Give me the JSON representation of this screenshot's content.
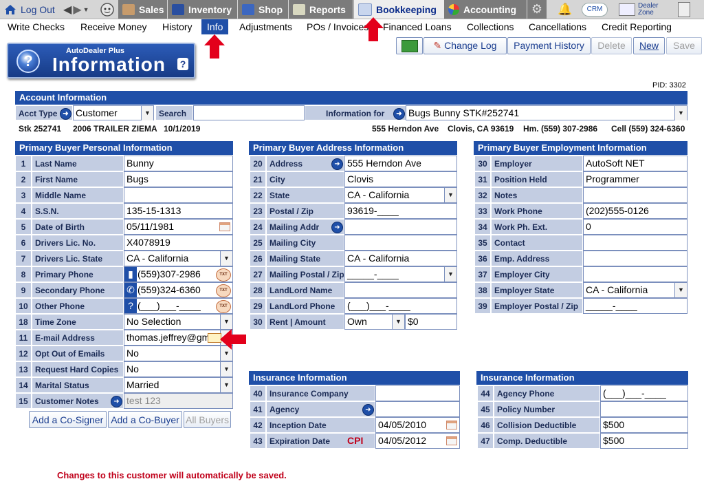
{
  "topnav": {
    "logout": "Log Out",
    "tabs": [
      {
        "label": "Sales",
        "icon": "sales-icon"
      },
      {
        "label": "Inventory",
        "icon": "car-icon"
      },
      {
        "label": "Shop",
        "icon": "wrench-icon"
      },
      {
        "label": "Reports",
        "icon": "report-icon"
      },
      {
        "label": "Bookkeeping",
        "icon": "book-icon"
      },
      {
        "label": "Accounting",
        "icon": "pie-icon"
      }
    ],
    "crm": "CRM",
    "dealer_zone": [
      "Dealer",
      "Zone"
    ]
  },
  "subnav": [
    "Write Checks",
    "Receive Money",
    "History",
    "Info",
    "Adjustments",
    "POs / Invoices",
    "Financed Loans",
    "Collections",
    "Cancellations",
    "Credit Reporting"
  ],
  "logo": {
    "sub": "AutoDealer Plus",
    "main": "Information",
    "q": "?",
    "help": "?"
  },
  "toolbar": {
    "change_log": "Change Log",
    "payment_history": "Payment History",
    "delete": "Delete",
    "new": "New",
    "save": "Save"
  },
  "pid": "PID: 3302",
  "account": {
    "header": "Account Information",
    "acct_type_label": "Acct Type",
    "acct_type_value": "Customer",
    "search_label": "Search",
    "search_value": "",
    "info_for_label": "Information for",
    "info_for_value": "Bugs Bunny STK#252741",
    "stk": "Stk 252741",
    "vehicle": "2006 TRAILER ZIEMA",
    "date": "10/1/2019",
    "address": "555 Herndon Ave",
    "city": "Clovis, CA 93619",
    "home": "Hm. (559) 307-2986",
    "cell": "Cell (559) 324-6360"
  },
  "personal": {
    "header": "Primary Buyer Personal Information",
    "rows": [
      {
        "num": "1",
        "label": "Last Name",
        "value": "Bunny"
      },
      {
        "num": "2",
        "label": "First Name",
        "value": "Bugs"
      },
      {
        "num": "3",
        "label": "Middle Name",
        "value": ""
      },
      {
        "num": "4",
        "label": "S.S.N.",
        "value": "135-15-1313"
      },
      {
        "num": "5",
        "label": "Date of Birth",
        "value": "05/11/1981"
      },
      {
        "num": "6",
        "label": "Drivers Lic. No.",
        "value": "X4078919"
      },
      {
        "num": "7",
        "label": "Drivers Lic. State",
        "value": "CA - California"
      },
      {
        "num": "8",
        "label": "Primary Phone",
        "value": "(559)307-2986"
      },
      {
        "num": "9",
        "label": "Secondary Phone",
        "value": "(559)324-6360"
      },
      {
        "num": "10",
        "label": "Other Phone",
        "value": "(___)___-____"
      },
      {
        "num": "18",
        "label": "Time Zone",
        "value": "No Selection"
      },
      {
        "num": "11",
        "label": "E-mail Address",
        "value": "thomas.jeffrey@gm"
      },
      {
        "num": "12",
        "label": "Opt Out of Emails",
        "value": "No"
      },
      {
        "num": "13",
        "label": "Request Hard Copies",
        "value": "No"
      },
      {
        "num": "14",
        "label": "Marital Status",
        "value": "Married"
      },
      {
        "num": "15",
        "label": "Customer Notes",
        "value": "test 123"
      }
    ],
    "txt": "TXT"
  },
  "address": {
    "header": "Primary Buyer Address Information",
    "rows": [
      {
        "num": "20",
        "label": "Address",
        "value": "555 Herndon Ave"
      },
      {
        "num": "21",
        "label": "City",
        "value": "Clovis"
      },
      {
        "num": "22",
        "label": "State",
        "value": "CA - California"
      },
      {
        "num": "23",
        "label": "Postal / Zip",
        "value": "93619-____"
      },
      {
        "num": "24",
        "label": "Mailing Addr",
        "value": ""
      },
      {
        "num": "25",
        "label": "Mailing City",
        "value": ""
      },
      {
        "num": "26",
        "label": "Mailing State",
        "value": "CA - California"
      },
      {
        "num": "27",
        "label": "Mailing Postal / Zip",
        "value": "_____-____"
      },
      {
        "num": "28",
        "label": "LandLord Name",
        "value": ""
      },
      {
        "num": "29",
        "label": "LandLord Phone",
        "value": "(___)___-____"
      },
      {
        "num": "30",
        "label": "Rent | Amount",
        "value": "Own",
        "amount": "$0"
      }
    ]
  },
  "employment": {
    "header": "Primary Buyer Employment Information",
    "rows": [
      {
        "num": "30",
        "label": "Employer",
        "value": "AutoSoft NET"
      },
      {
        "num": "31",
        "label": "Position Held",
        "value": "Programmer"
      },
      {
        "num": "32",
        "label": "Notes",
        "value": ""
      },
      {
        "num": "33",
        "label": "Work Phone",
        "value": "(202)555-0126"
      },
      {
        "num": "34",
        "label": "Work Ph. Ext.",
        "value": "0"
      },
      {
        "num": "35",
        "label": "Contact",
        "value": ""
      },
      {
        "num": "36",
        "label": "Emp. Address",
        "value": ""
      },
      {
        "num": "37",
        "label": "Employer City",
        "value": ""
      },
      {
        "num": "38",
        "label": "Employer State",
        "value": "CA - California"
      },
      {
        "num": "39",
        "label": "Employer Postal / Zip",
        "value": "_____-____"
      }
    ]
  },
  "insurance_left": {
    "header": "Insurance Information",
    "cpi": "CPI",
    "rows": [
      {
        "num": "40",
        "label": "Insurance Company",
        "value": ""
      },
      {
        "num": "41",
        "label": "Agency",
        "value": ""
      },
      {
        "num": "42",
        "label": "Inception Date",
        "value": "04/05/2010"
      },
      {
        "num": "43",
        "label": "Expiration Date",
        "value": "04/05/2012"
      }
    ]
  },
  "insurance_right": {
    "header": "Insurance Information",
    "rows": [
      {
        "num": "44",
        "label": "Agency Phone",
        "value": "(___)___-____"
      },
      {
        "num": "45",
        "label": "Policy Number",
        "value": ""
      },
      {
        "num": "46",
        "label": "Collision Deductible",
        "value": "$500"
      },
      {
        "num": "47",
        "label": "Comp. Deductible",
        "value": "$500"
      }
    ]
  },
  "buttons": {
    "co_signer": "Add a Co-Signer",
    "co_buyer": "Add a Co-Buyer",
    "all_buyers": "All Buyers"
  },
  "note": "Changes to this customer will automatically be saved.",
  "colors": {
    "accent": "#1f4fa8",
    "label_bg": "#c3cde2",
    "alert": "#e3001b"
  }
}
